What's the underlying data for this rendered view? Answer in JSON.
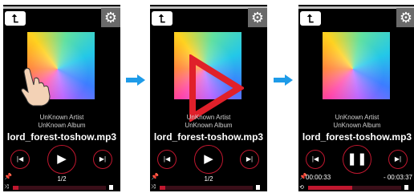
{
  "track": {
    "artist": "UnKnown Artist",
    "album": "UnKnown Album",
    "filename": "lord_forest-toshow.mp3",
    "track_count": "1/2"
  },
  "states": [
    {
      "play_symbol": "▶",
      "progress": 0.06
    },
    {
      "play_symbol": "▶",
      "progress": 0.06
    },
    {
      "play_symbol": "❚❚",
      "progress": 0.47,
      "elapsed": "00:00:33",
      "remaining": "- 00:03:37"
    }
  ],
  "controls": {
    "back_symbol": "⮤",
    "settings_symbol": "⚙",
    "prev_symbol": "|◀",
    "next_symbol": "▶|"
  },
  "colors": {
    "accent": "#c0172f",
    "arrow": "#1e9be8",
    "triangle": "#e0202a"
  }
}
